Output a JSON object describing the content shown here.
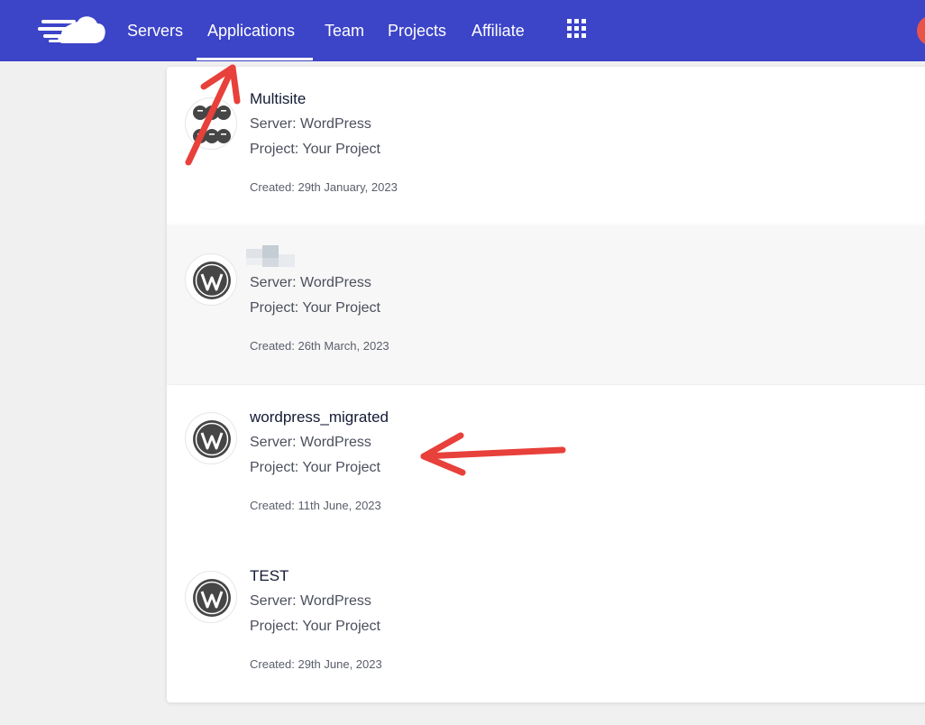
{
  "nav": {
    "items": [
      {
        "label": "Servers",
        "active": false
      },
      {
        "label": "Applications",
        "active": true
      },
      {
        "label": "Team",
        "active": false
      },
      {
        "label": "Projects",
        "active": false
      },
      {
        "label": "Affiliate",
        "active": false
      }
    ],
    "apps_icon": "grid-icon",
    "logo_icon": "cloud-logo-icon"
  },
  "applications": [
    {
      "name": "Multisite",
      "server": "Server: WordPress",
      "project": "Project: Your Project",
      "created": "Created: 29th January, 2023",
      "icon": "wordpress-multisite-icon"
    },
    {
      "name": "",
      "server": "Server: WordPress",
      "project": "Project: Your Project",
      "created": "Created: 26th March, 2023",
      "icon": "wordpress-icon"
    },
    {
      "name": "wordpress_migrated",
      "server": "Server: WordPress",
      "project": "Project: Your Project",
      "created": "Created: 11th June, 2023",
      "icon": "wordpress-icon"
    },
    {
      "name": "TEST",
      "server": "Server: WordPress",
      "project": "Project: Your Project",
      "created": "Created: 29th June, 2023",
      "icon": "wordpress-icon"
    }
  ],
  "colors": {
    "nav_background": "#3c44c8",
    "annotation_arrow": "#e8403a"
  }
}
